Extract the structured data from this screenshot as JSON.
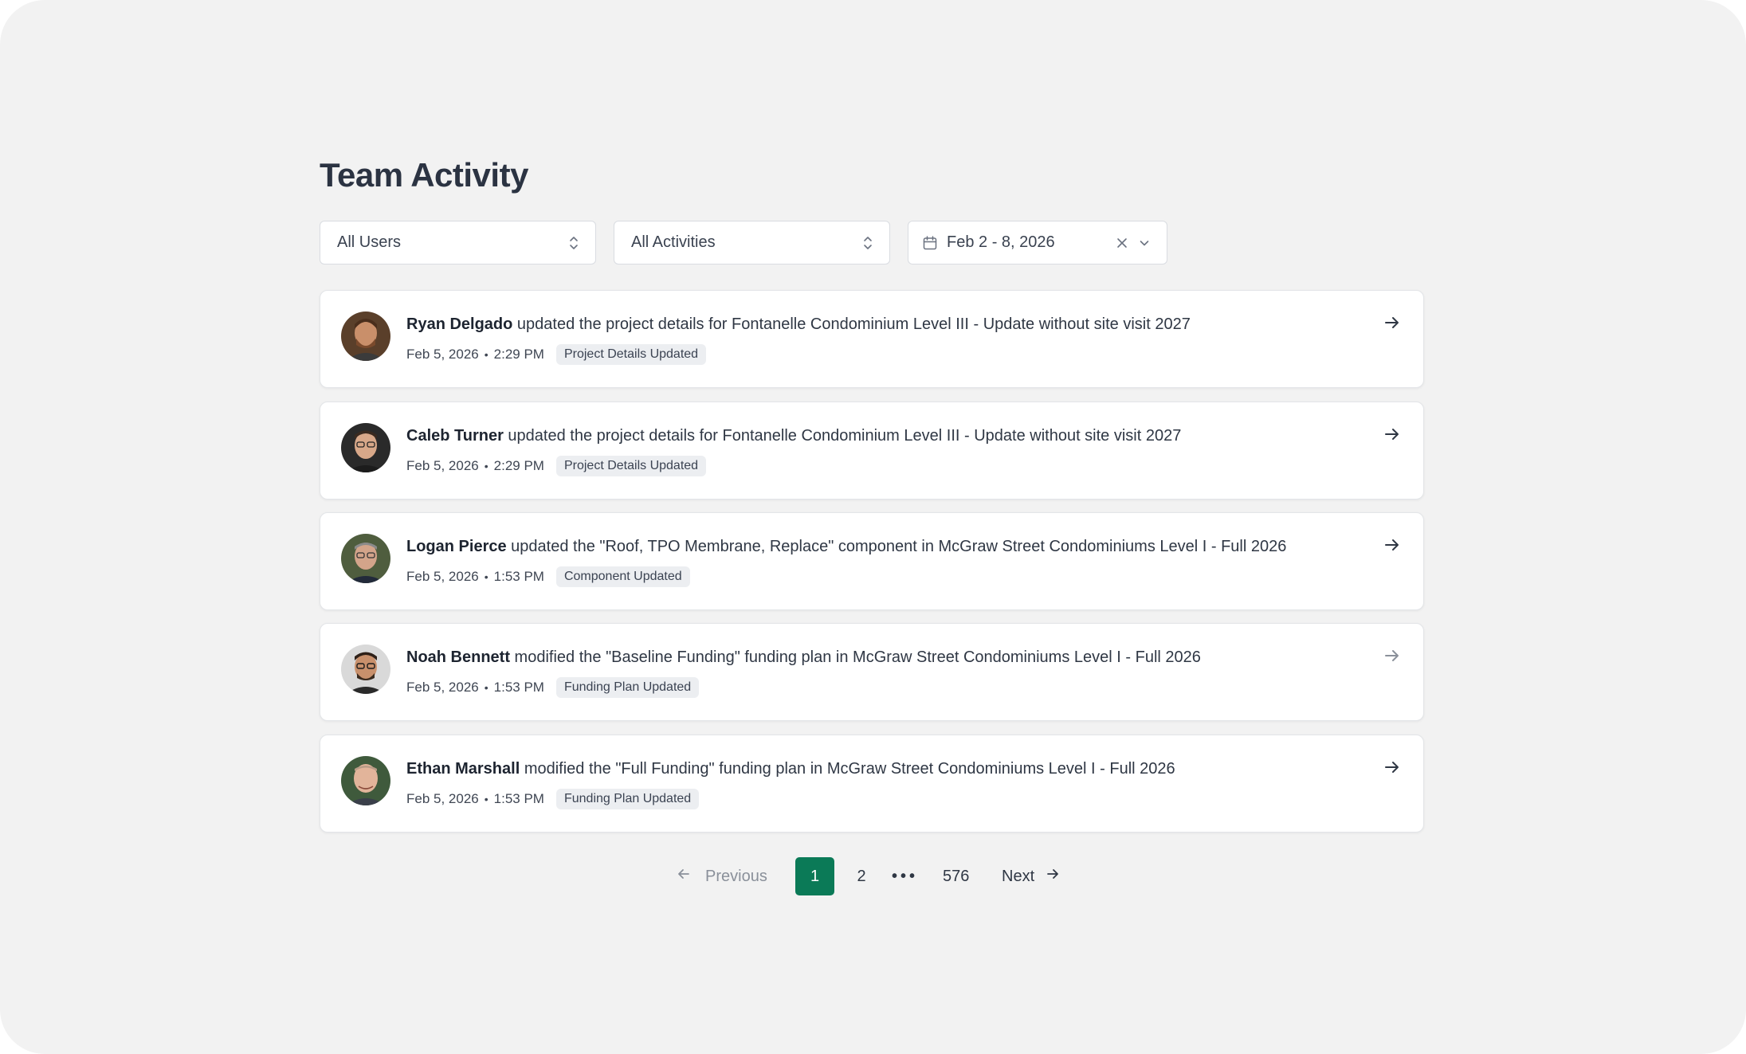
{
  "page": {
    "title": "Team Activity"
  },
  "filters": {
    "users": "All Users",
    "activities": "All Activities",
    "date_range": "Feb 2 - 8, 2026"
  },
  "activities": [
    {
      "user": "Ryan Delgado",
      "action": " updated the project details for Fontanelle Condominium Level III - Update without site visit 2027",
      "date": "Feb 5, 2026",
      "time": "2:29 PM",
      "tag": "Project Details Updated"
    },
    {
      "user": "Caleb Turner",
      "action": " updated the project details for Fontanelle Condominium Level III - Update without site visit 2027",
      "date": "Feb 5, 2026",
      "time": "2:29 PM",
      "tag": "Project Details Updated"
    },
    {
      "user": "Logan Pierce",
      "action": " updated the \"Roof, TPO Membrane, Replace\" component in McGraw Street Condominiums Level I - Full 2026",
      "date": "Feb 5, 2026",
      "time": "1:53 PM",
      "tag": "Component Updated"
    },
    {
      "user": "Noah Bennett",
      "action": " modified the \"Baseline Funding\" funding plan in McGraw Street Condominiums Level I - Full 2026",
      "date": "Feb 5, 2026",
      "time": "1:53 PM",
      "tag": "Funding Plan Updated"
    },
    {
      "user": "Ethan Marshall",
      "action": " modified the \"Full Funding\" funding plan in McGraw Street Condominiums Level I - Full 2026",
      "date": "Feb 5, 2026",
      "time": "1:53 PM",
      "tag": "Funding Plan Updated"
    }
  ],
  "pagination": {
    "previous": "Previous",
    "current": "1",
    "page_2": "2",
    "ellipsis": "•••",
    "last": "576",
    "next": "Next"
  },
  "colors": {
    "background": "#f2f2f2",
    "accent": "#0b7a57",
    "badge_bg": "#eceef1"
  },
  "icons": [
    "updown-chevron-icon",
    "calendar-icon",
    "clear-x-icon",
    "chevron-down-icon",
    "arrow-right-icon",
    "arrow-left-icon"
  ]
}
